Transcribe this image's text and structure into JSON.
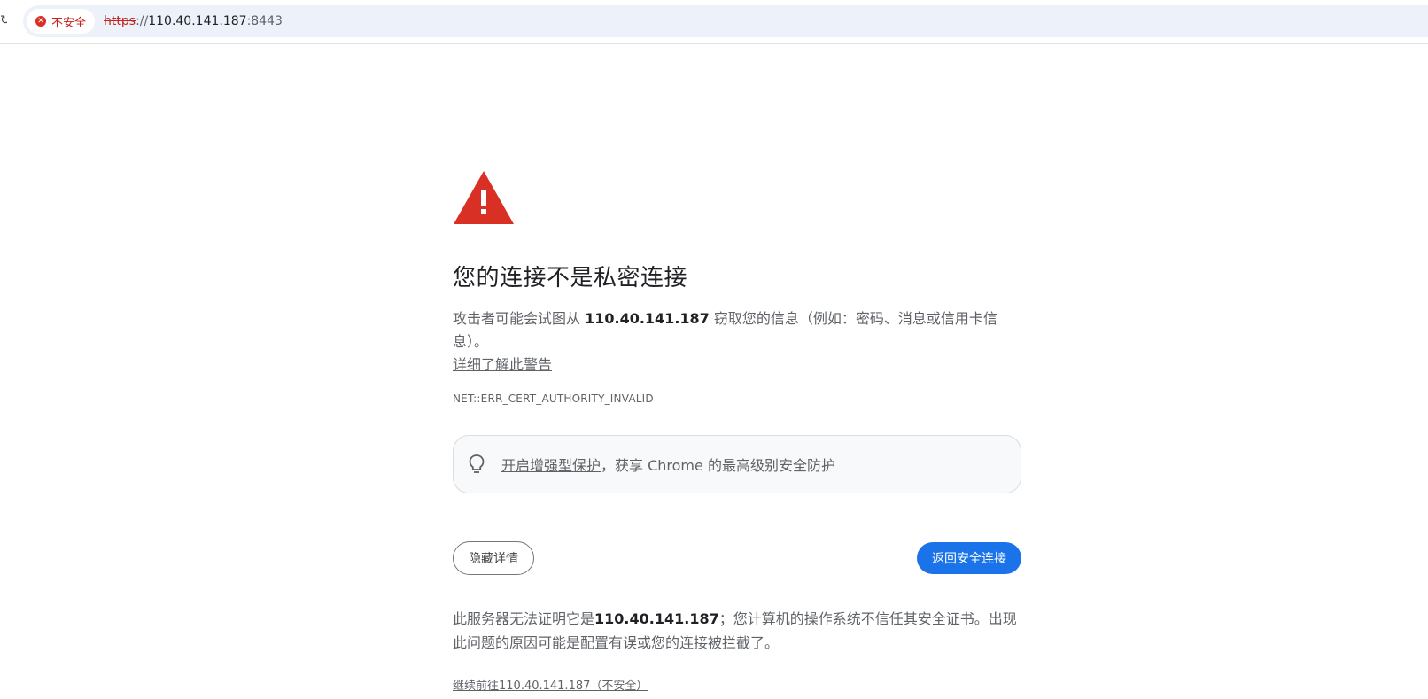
{
  "address_bar": {
    "security_chip": "不安全",
    "url_scheme": "https",
    "url_sep": "://",
    "url_host": "110.40.141.187",
    "url_port": ":8443"
  },
  "interstitial": {
    "heading": "您的连接不是私密连接",
    "warning_prefix": "攻击者可能会试图从 ",
    "warning_host": "110.40.141.187",
    "warning_suffix": " 窃取您的信息（例如：密码、消息或信用卡信息）。",
    "learn_more": "详细了解此警告",
    "error_code": "NET::ERR_CERT_AUTHORITY_INVALID",
    "enhanced_link": "开启增强型保护",
    "enhanced_suffix": "，获享 Chrome 的最高级别安全防护",
    "hide_details": "隐藏详情",
    "back_to_safety": "返回安全连接",
    "details_prefix": "此服务器无法证明它是",
    "details_host": "110.40.141.187",
    "details_suffix": "；您计算机的操作系统不信任其安全证书。出现此问题的原因可能是配置有误或您的连接被拦截了。",
    "proceed_link": "继续前往110.40.141.187（不安全）"
  },
  "colors": {
    "danger": "#d93025",
    "primary": "#1a73e8",
    "text_secondary": "#5f6368"
  },
  "icons": {
    "chip": "error-circle-icon",
    "warning": "warning-triangle-icon",
    "enhanced": "lightbulb-icon"
  }
}
